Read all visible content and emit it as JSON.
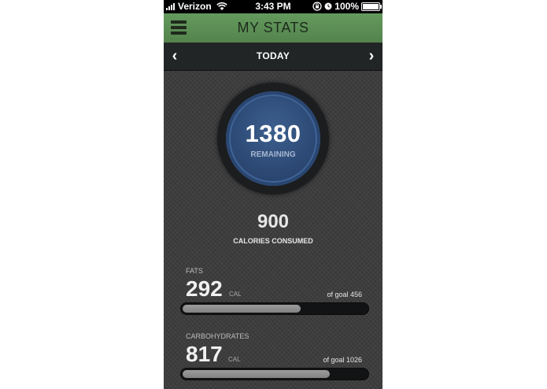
{
  "status_bar": {
    "carrier": "Verizon",
    "time": "3:43 PM",
    "battery": "100%",
    "icons": [
      "signal-icon",
      "wifi-icon",
      "rotation-lock-icon",
      "alarm-icon",
      "battery-icon"
    ]
  },
  "header": {
    "title": "MY STATS",
    "menu_icon": "hamburger-menu-icon",
    "color": "#5c8f55"
  },
  "date_nav": {
    "label": "TODAY",
    "prev_icon": "chevron-left-icon",
    "next_icon": "chevron-right-icon",
    "prev_glyph": "‹",
    "next_glyph": "›"
  },
  "summary": {
    "remaining_value": "1380",
    "remaining_label": "REMAINING",
    "consumed_value": "900",
    "consumed_label": "CALORIES CONSUMED"
  },
  "macros": [
    {
      "name": "FATS",
      "value": "292",
      "unit": "CAL",
      "goal_label": "of goal 456",
      "progress": 0.64
    },
    {
      "name": "CARBOHYDRATES",
      "value": "817",
      "unit": "CAL",
      "goal_label": "of goal 1026",
      "progress": 0.8
    }
  ]
}
